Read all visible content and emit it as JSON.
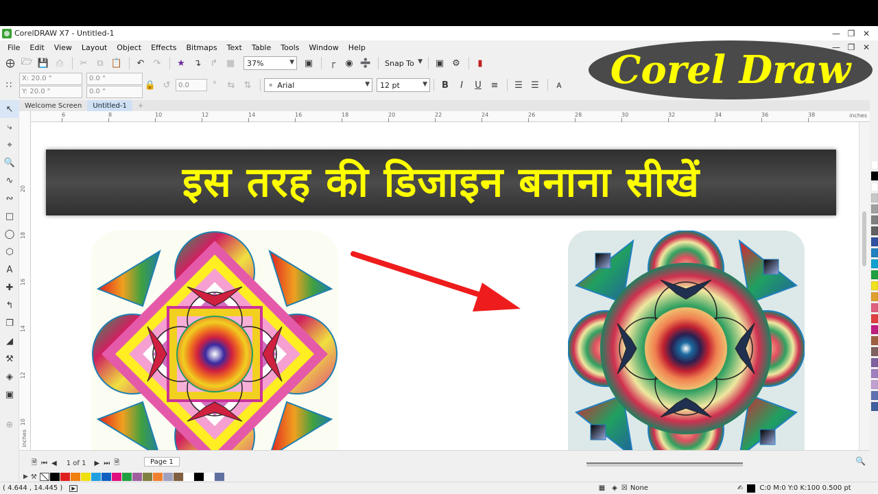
{
  "window": {
    "title": "CorelDRAW X7 - Untitled-1"
  },
  "menu": [
    "File",
    "Edit",
    "View",
    "Layout",
    "Object",
    "Effects",
    "Bitmaps",
    "Text",
    "Table",
    "Tools",
    "Window",
    "Help"
  ],
  "toolbar": {
    "zoom": "37%",
    "snap_to": "Snap To"
  },
  "property_bar": {
    "x": "X: 20.0 \"",
    "y": "Y: 20.0 \"",
    "w": "0.0 \"",
    "h": "0.0 \"",
    "angle": "0.0",
    "font": "Arial",
    "size": "12 pt"
  },
  "doc_tabs": [
    "Welcome Screen",
    "Untitled-1"
  ],
  "ruler": {
    "h_ticks": [
      "6",
      "8",
      "10",
      "12",
      "14",
      "16",
      "18",
      "20",
      "22",
      "24",
      "26",
      "28",
      "30",
      "32",
      "34",
      "36",
      "38"
    ],
    "v_ticks": [
      "20",
      "18",
      "16",
      "14",
      "12",
      "10"
    ],
    "unit": "inches"
  },
  "banner": {
    "text": "इस तरह की डिजाइन बनाना सीखें"
  },
  "badge": {
    "text": "Corel Draw"
  },
  "page_nav": {
    "count": "1 of 1",
    "page_tab": "Page 1"
  },
  "status": {
    "coords": "( 4.644 , 14.445 )",
    "fill": "None",
    "outline": "C:0 M:0 Y:0 K:100  0.500 pt"
  },
  "palette": [
    "#ffffff",
    "#000000",
    "#ffffff",
    "#c8c8c8",
    "#a0a0a0",
    "#808080",
    "#606060",
    "#3050a0",
    "#2080c0",
    "#10a0d0",
    "#20a040",
    "#f0e020",
    "#e0a030",
    "#e06080",
    "#e04040",
    "#c02080",
    "#a06040",
    "#806060",
    "#8060a0",
    "#a080c0",
    "#c0a0d0",
    "#6070b0",
    "#4060a0"
  ],
  "doc_palette": [
    "#000000",
    "#e02020",
    "#f08010",
    "#f0e010",
    "#20a0e0",
    "#1060c0",
    "#e01080",
    "#20a040",
    "#a060a0",
    "#808040",
    "#f08030",
    "#a0a0c0",
    "#806040",
    "#ffffff",
    "#000000",
    "#ffffff",
    "#6070a0"
  ]
}
